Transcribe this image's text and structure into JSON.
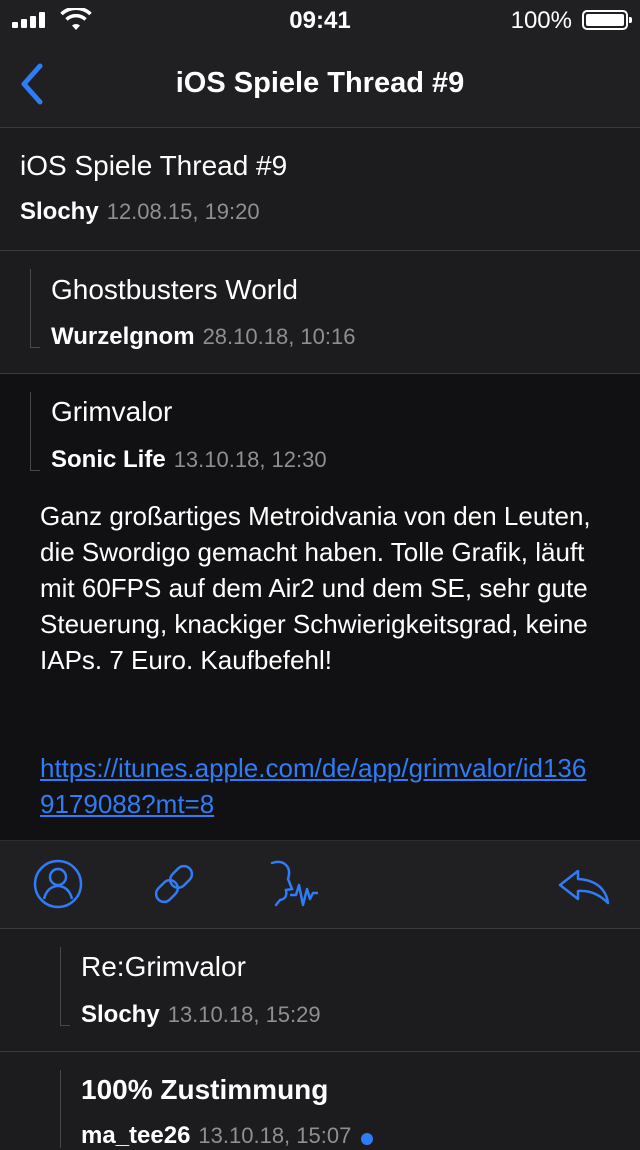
{
  "status_bar": {
    "time": "09:41",
    "battery_percent": "100%"
  },
  "navbar": {
    "title": "iOS Spiele Thread #9",
    "back_icon": "chevron-left-icon"
  },
  "thread": {
    "title": "iOS Spiele Thread #9",
    "author": "Slochy",
    "date": "12.08.15, 19:20"
  },
  "posts": [
    {
      "title": "Ghostbusters World",
      "author": "Wurzelgnom",
      "date": "28.10.18, 10:16"
    },
    {
      "title": "Grimvalor",
      "author": "Sonic Life",
      "date": "13.10.18, 12:30",
      "body": "Ganz großartiges Metroidvania von den Leuten, die Swordigo gemacht haben. Tolle Grafik, läuft mit 60FPS auf dem Air2 und dem SE, sehr gute Steuerung, knackiger Schwierigkeitsgrad, keine IAPs. 7 Euro. Kaufbefehl!",
      "link": "https://itunes.apple.com/de/app/grimvalor/id1369179088?mt=8"
    },
    {
      "title": "Re:Grimvalor",
      "author": "Slochy",
      "date": "13.10.18, 15:29"
    },
    {
      "title": "100% Zustimmung",
      "author": "ma_tee26",
      "date": "13.10.18, 15:07"
    }
  ],
  "actions": {
    "icons": [
      "profile-icon",
      "link-icon",
      "speak-icon",
      "reply-icon"
    ]
  },
  "colors": {
    "accent": "#2f7cf6",
    "background": "#1c1c1e",
    "selected_post": "#111113",
    "toolbar": "#202022",
    "meta_gray": "#8e8e93"
  }
}
